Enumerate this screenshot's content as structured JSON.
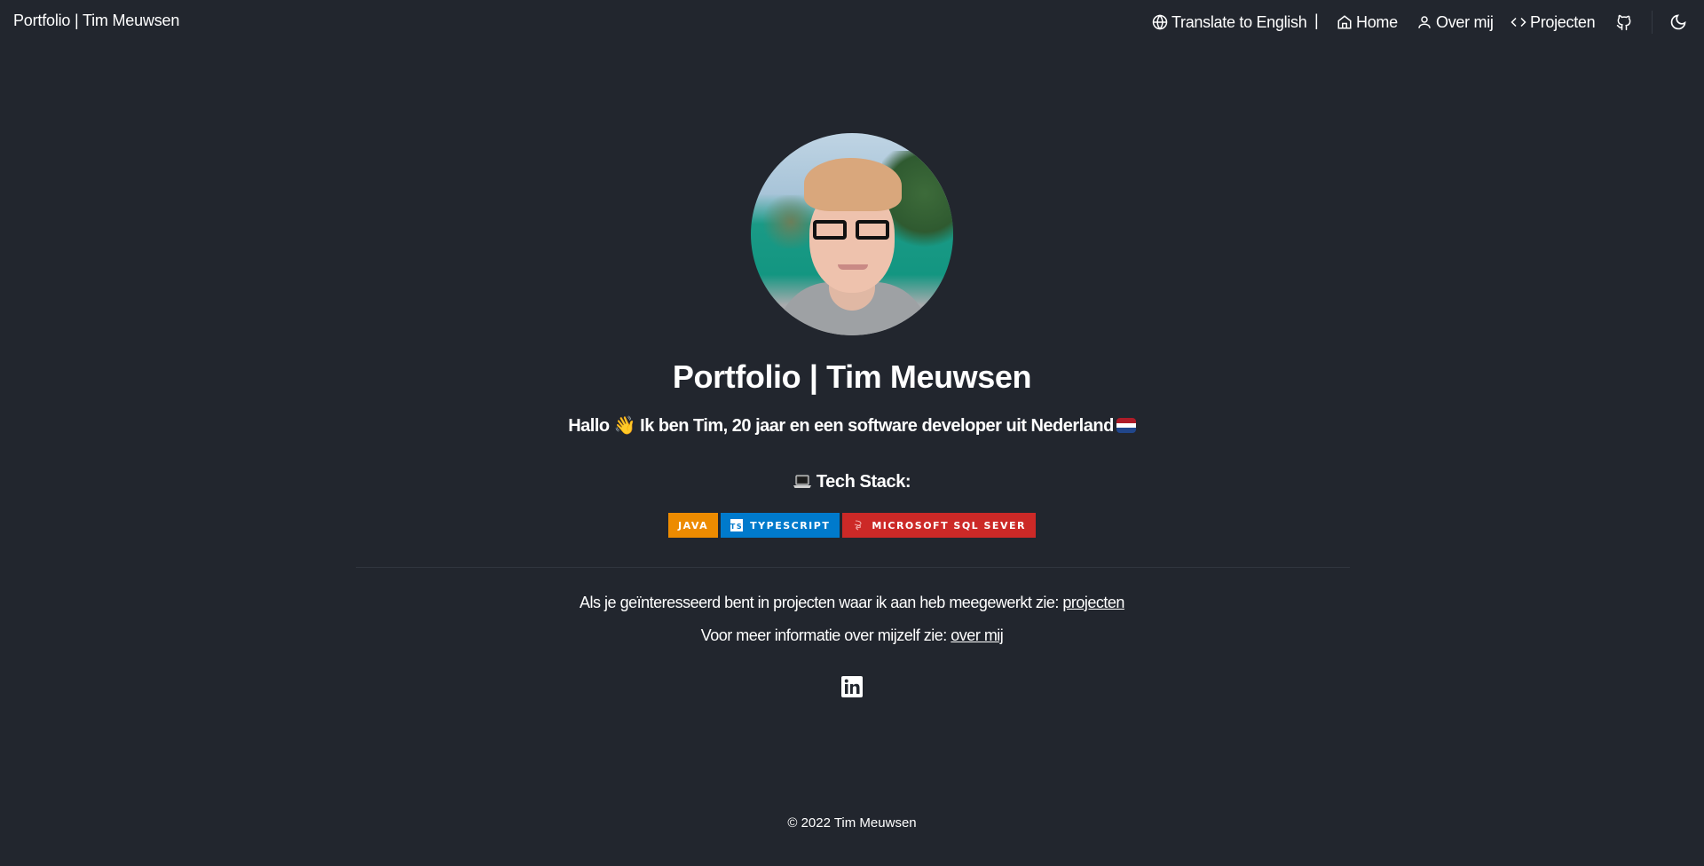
{
  "navbar": {
    "brand": "Portfolio | Tim Meuwsen",
    "translate_label": "Translate to English",
    "separator": "|",
    "items": [
      {
        "label": "Home",
        "icon": "home-icon"
      },
      {
        "label": "Over mij",
        "icon": "user-icon"
      },
      {
        "label": "Projecten",
        "icon": "code-icon"
      }
    ],
    "github_icon": "github-icon",
    "theme_toggle_icon": "moon-icon"
  },
  "hero": {
    "avatar_alt": "Tim Meuwsen",
    "title": "Portfolio | Tim Meuwsen",
    "intro_prefix": "Hallo",
    "intro_emoji": "👋",
    "intro_text": "Ik ben Tim, 20 jaar en een software developer uit Nederland",
    "flag": {
      "name": "netherlands-flag",
      "colors": [
        "#ae1c28",
        "#ffffff",
        "#21468b"
      ]
    },
    "stack_title": "Tech Stack:"
  },
  "badges": [
    {
      "label": "JAVA",
      "color": "#ed8b00",
      "icon": ""
    },
    {
      "label": "TYPESCRIPT",
      "color": "#007acc",
      "icon": "typescript-icon"
    },
    {
      "label": "MICROSOFT SQL SEVER",
      "color": "#cc2927",
      "icon": "mssql-icon"
    }
  ],
  "info": {
    "projects_text": "Als je geïnteresseerd bent in projecten waar ik aan heb meegewerkt zie: ",
    "projects_link": "projecten",
    "about_text": "Voor meer informatie over mijzelf zie: ",
    "about_link": "over mij"
  },
  "social": {
    "linkedin_icon": "linkedin-icon"
  },
  "footer": {
    "copyright": "© 2022 Tim Meuwsen"
  }
}
